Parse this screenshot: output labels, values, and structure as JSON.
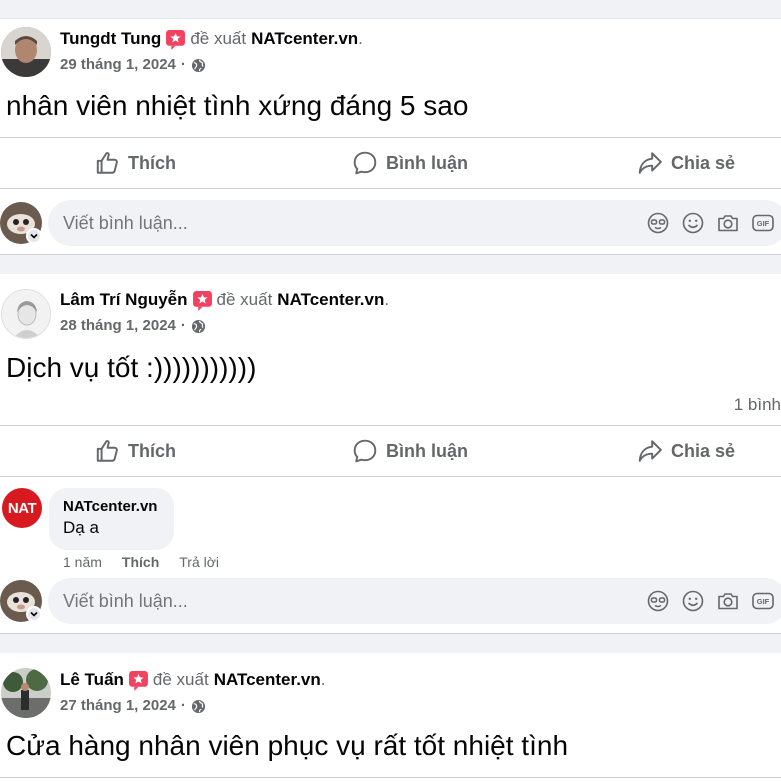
{
  "posts": [
    {
      "author": "Tungdt Tung",
      "verb": "đề xuất",
      "page": "NATcenter.vn",
      "date": "29 tháng 1, 2024",
      "text": "nhân viên nhiệt tình xứng đáng 5 sao"
    },
    {
      "author": "Lâm Trí Nguyễn",
      "verb": "đề xuất",
      "page": "NATcenter.vn",
      "date": "28 tháng 1, 2024",
      "text": "Dịch vụ tốt :)))))))))))",
      "comment_count": "1 bình",
      "reply": {
        "avatar_text": "NAT",
        "name": "NATcenter.vn",
        "text": "Dạ a",
        "time": "1 năm",
        "like": "Thích",
        "reply": "Trả lời"
      }
    },
    {
      "author": "Lê Tuấn",
      "verb": "đề xuất",
      "page": "NATcenter.vn",
      "date": "27 tháng 1, 2024",
      "text": "Cửa hàng nhân viên phục vụ rất tốt nhiệt tình"
    }
  ],
  "actions": {
    "like": "Thích",
    "comment": "Bình luận",
    "share": "Chia sẻ"
  },
  "comment_input": {
    "placeholder": "Viết bình luận..."
  },
  "punct": {
    "dot": ".",
    "sep": "·"
  },
  "icons": [
    "recommend-badge-icon",
    "globe-icon",
    "thumbs-up-icon",
    "comment-bubble-icon",
    "share-arrow-icon",
    "avatar-sticker-icon",
    "emoji-icon",
    "camera-icon",
    "gif-icon",
    "chevron-down-icon"
  ],
  "colors": {
    "badge": "#f3425f",
    "muted": "#65676b",
    "nat_red": "#d71920"
  }
}
